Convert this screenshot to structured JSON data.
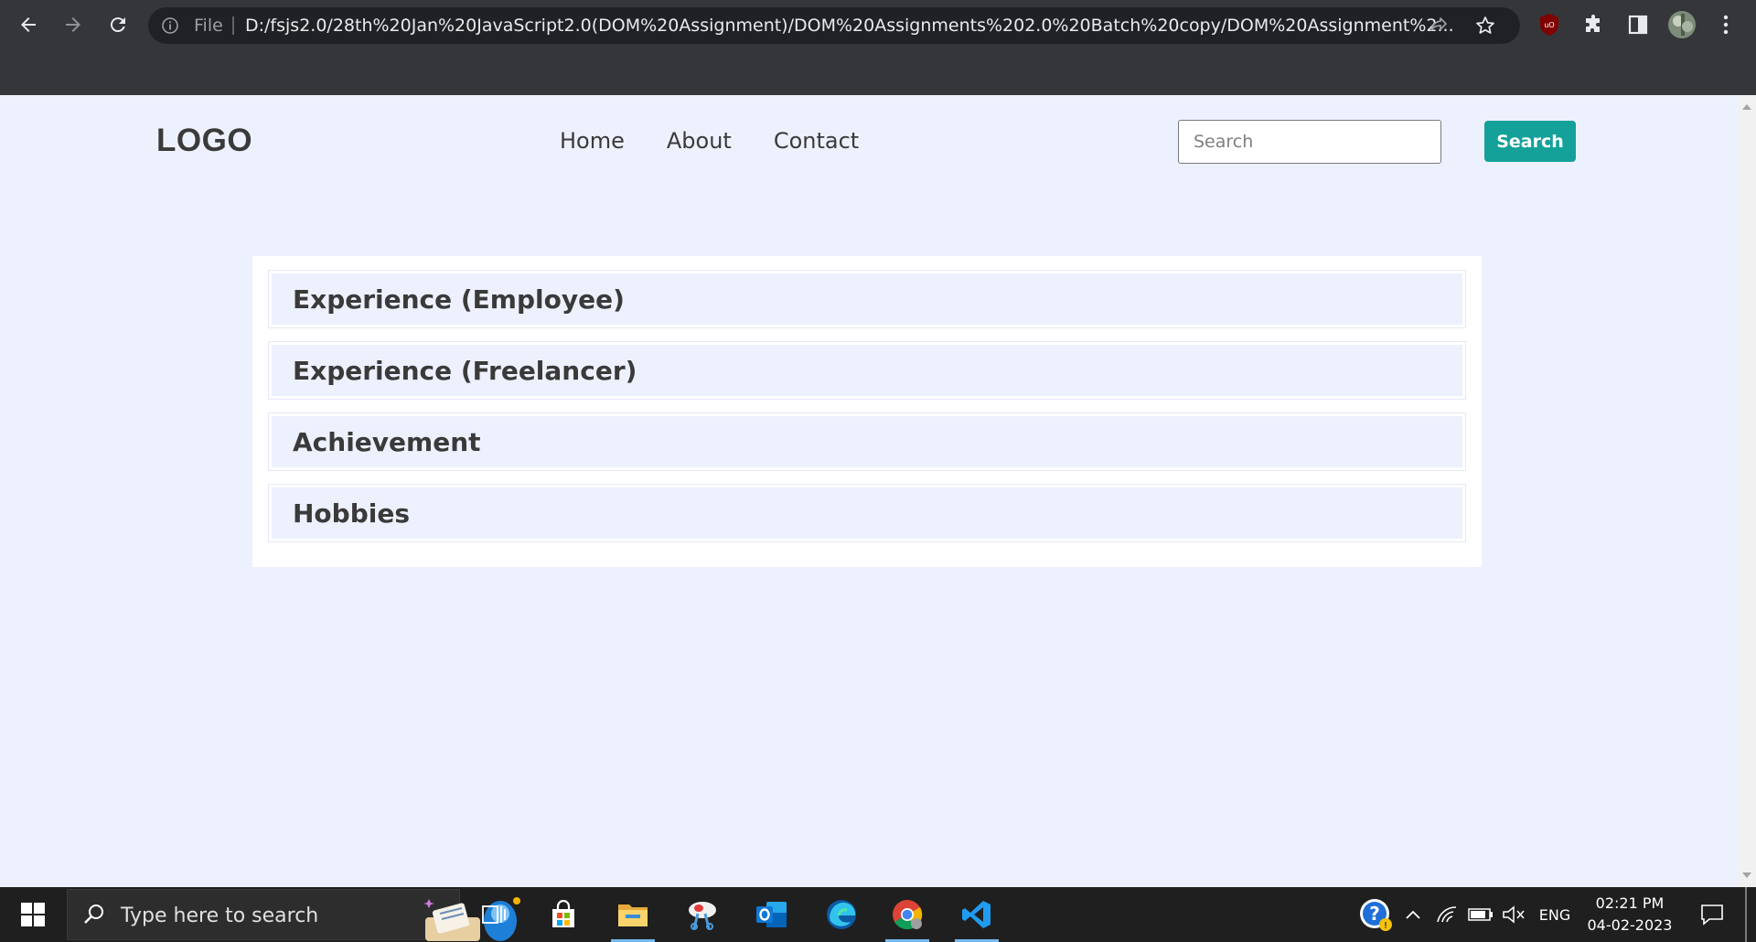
{
  "browser": {
    "omnibox": {
      "scheme_label": "File",
      "url": "D:/fsjs2.0/28th%20Jan%20JavaScript2.0(DOM%20Assignment)/DOM%20Assignments%202.0%20Batch%20copy/DOM%20Assignment%2..."
    },
    "toolbar_icons": [
      "back-icon",
      "forward-icon",
      "reload-icon",
      "info-icon",
      "share-icon",
      "star-icon",
      "ublock-icon",
      "extensions-icon",
      "side-panel-icon",
      "profile-avatar",
      "menu-icon"
    ]
  },
  "page": {
    "logo": "LOGO",
    "nav": {
      "home": "Home",
      "about": "About",
      "contact": "Contact"
    },
    "search": {
      "placeholder": "Search",
      "value": "",
      "button_label": "Search"
    },
    "accordion": [
      {
        "title": "Experience (Employee)"
      },
      {
        "title": "Experience (Freelancer)"
      },
      {
        "title": "Achievement"
      },
      {
        "title": "Hobbies"
      }
    ],
    "colors": {
      "background": "#edf1fd",
      "accent": "#14a19a",
      "text": "#3a3a3a"
    }
  },
  "taskbar": {
    "search_placeholder": "Type here to search",
    "apps": [
      "task-view-icon",
      "microsoft-store-icon",
      "file-explorer-icon",
      "snipping-tool-icon",
      "outlook-icon",
      "edge-icon",
      "chrome-icon",
      "vscode-icon"
    ],
    "tray": {
      "language": "ENG",
      "time": "02:21 PM",
      "date": "04-02-2023"
    }
  }
}
